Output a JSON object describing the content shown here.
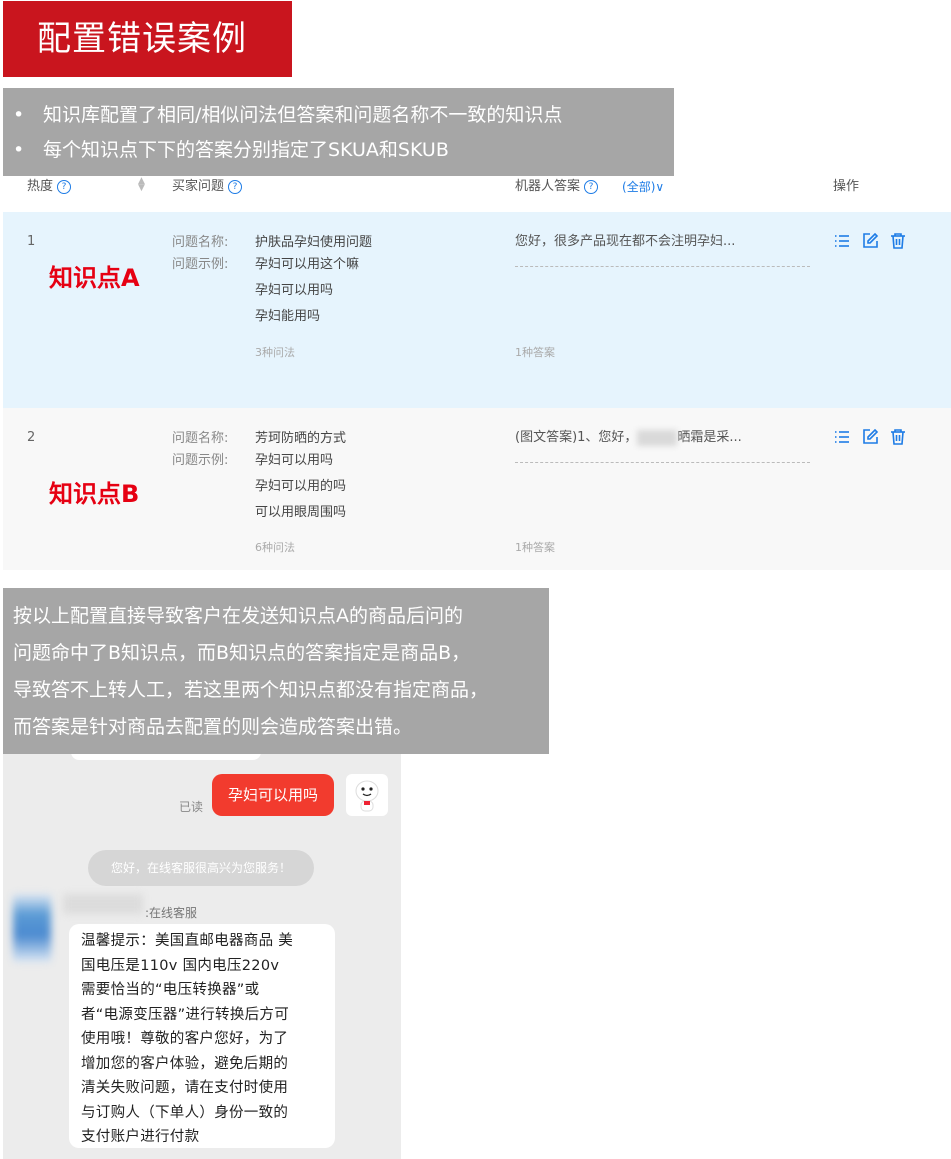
{
  "banner": {
    "title": "配置错误案例"
  },
  "notes": [
    {
      "bullet": "•",
      "text": "知识库配置了相同/相似问法但答案和问题名称不一致的知识点"
    },
    {
      "bullet": "•",
      "text": "每个知识点下下的答案分别指定了SKUA和SKUB"
    }
  ],
  "table": {
    "headers": {
      "heat": "热度",
      "question": "买家问题",
      "answer": "机器人答案",
      "filter": "(全部)",
      "ops": "操作"
    },
    "rows": [
      {
        "num": "1",
        "tag": "知识点A",
        "name_label": "问题名称:",
        "example_label": "问题示例:",
        "name": "护肤品孕妇使用问题",
        "examples": [
          "孕妇可以用这个嘛",
          "孕妇可以用吗",
          "孕妇能用吗"
        ],
        "question_count": "3种问法",
        "answer": "您好，很多产品现在都不会注明孕妇...",
        "answer_count": "1种答案"
      },
      {
        "num": "2",
        "tag": "知识点B",
        "name_label": "问题名称:",
        "example_label": "问题示例:",
        "name": "芳珂防晒的方式",
        "examples": [
          "孕妇可以用吗",
          "孕妇可以用的吗",
          "可以用眼周围吗"
        ],
        "question_count": "6种问法",
        "answer_prefix": "(图文答案)1、您好，",
        "answer_suffix": "晒霜是采...",
        "answer_count": "1种答案"
      }
    ]
  },
  "explanation": [
    "按以上配置直接导致客户在发送知识点A的商品后问的",
    "问题命中了B知识点，而B知识点的答案指定是商品B，",
    "导致答不上转人工，若这里两个知识点都没有指定商品，",
    "而答案是针对商品去配置的则会造成答案出错。"
  ],
  "chat": {
    "read": "已读",
    "user_message": "孕妇可以用吗",
    "system_message": "您好，在线客服很高兴为您服务！",
    "agent_name": "在线客服",
    "agent_message": [
      "温馨提示：美国直邮电器商品  美",
      "国电压是110v  国内电压220v",
      "需要恰当的“电压转换器”或",
      "者“电源变压器”进行转换后方可",
      "使用哦！尊敬的客户您好，为了",
      "增加您的客户体验，避免后期的",
      "清关失败问题，请在支付时使用",
      "与订购人（下单人）身份一致的",
      "支付账户进行付款"
    ]
  },
  "colors": {
    "banner": "#c9151e",
    "note_bg": "#a6a6a6",
    "row_highlight": "#e6f4fd",
    "accent": "#1e7ce6",
    "tag_red": "#e60012",
    "chat_bubble": "#f23b2e"
  },
  "icons": [
    "help-icon",
    "sort-icon",
    "list-icon",
    "edit-icon",
    "delete-icon",
    "user-avatar-icon",
    "agent-avatar-icon"
  ]
}
